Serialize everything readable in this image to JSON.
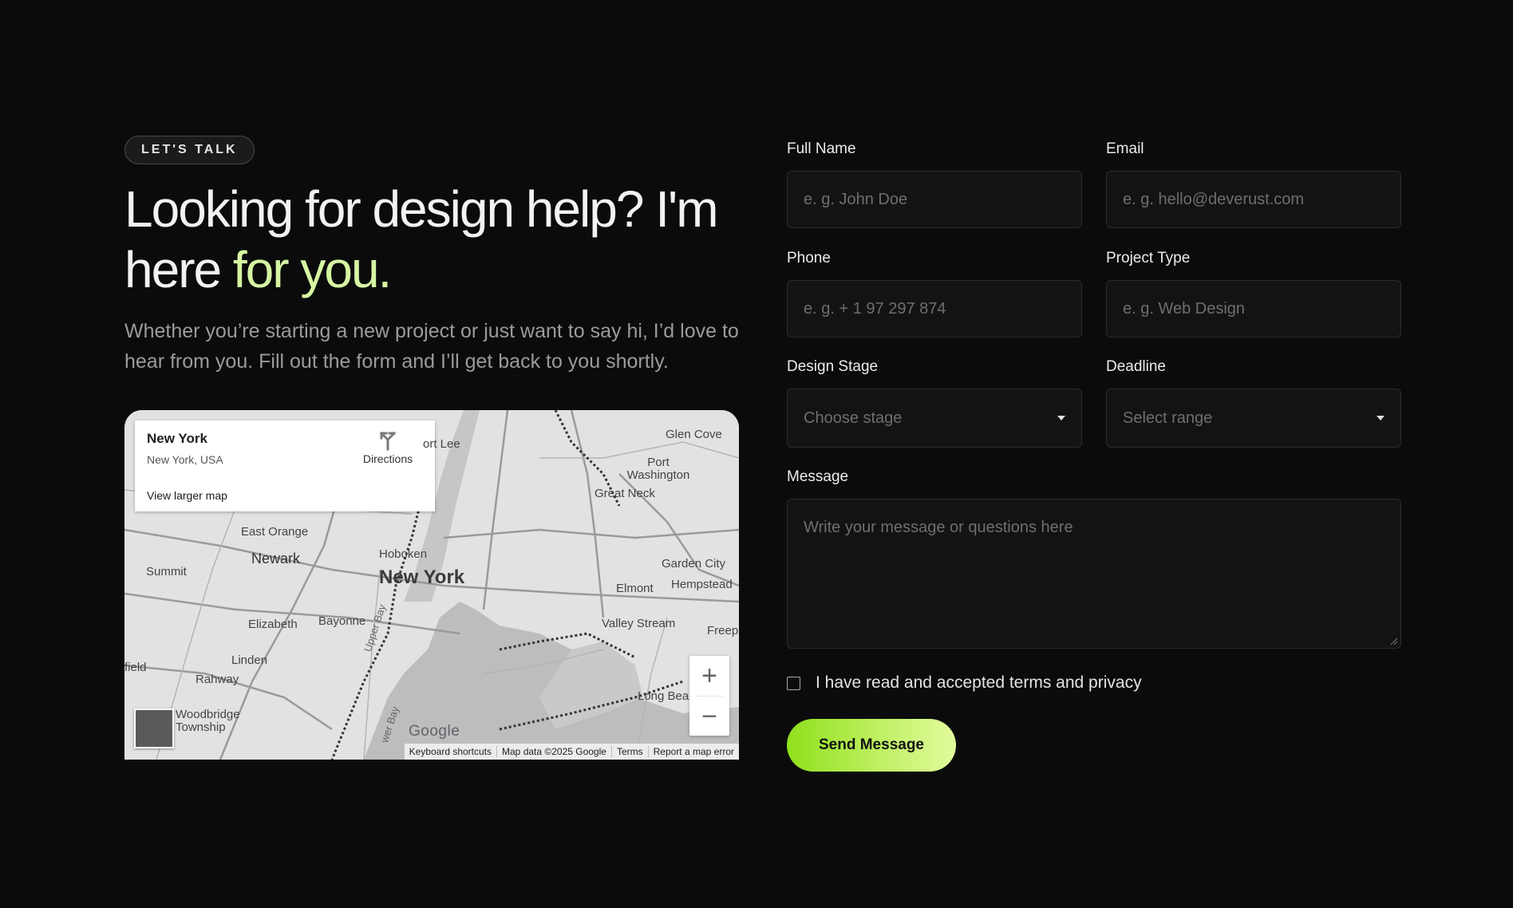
{
  "hero": {
    "badge": "LET'S TALK",
    "headline_line1": "Looking for design help? I'm",
    "headline_line2_plain": "here",
    "headline_line2_accent": "for you.",
    "lead": "Whether you’re starting a new project or just want to say hi, I’d love to hear from you. Fill out the form and I’ll get back to you shortly."
  },
  "map": {
    "place_title": "New York",
    "place_subtitle": "New York, USA",
    "view_larger": "View larger map",
    "directions_label": "Directions",
    "city_label": "New York",
    "labels": [
      "Glen Cove",
      "Port Washington",
      "Great Neck",
      "East Orange",
      "Newark",
      "Hoboken",
      "Summit",
      "Elizabeth",
      "Bayonne",
      "Garden City",
      "Hempstead",
      "Elmont",
      "Valley Stream",
      "Freep",
      "Linden",
      "Rahway",
      "Woodbridge Township",
      "field",
      "Upper Bay",
      "Long Beac",
      "ort Lee",
      "wer Bay"
    ],
    "google_logo": "Google",
    "attribution": [
      "Keyboard shortcuts",
      "Map data ©2025 Google",
      "Terms",
      "Report a map error"
    ],
    "zoom_in": "+",
    "zoom_out": "−"
  },
  "form": {
    "full_name": {
      "label": "Full Name",
      "placeholder": "e. g. John Doe"
    },
    "email": {
      "label": "Email",
      "placeholder": "e. g. hello@deverust.com"
    },
    "phone": {
      "label": "Phone",
      "placeholder": "e. g. + 1 97 297 874"
    },
    "project_type": {
      "label": "Project Type",
      "placeholder": "e. g. Web Design"
    },
    "design_stage": {
      "label": "Design Stage",
      "selected": "Choose stage"
    },
    "deadline": {
      "label": "Deadline",
      "selected": "Select range"
    },
    "message": {
      "label": "Message",
      "placeholder": "Write your message or questions here"
    },
    "terms": "I have read and accepted terms and privacy",
    "submit": "Send Message"
  },
  "colors": {
    "background": "#0b0b0b",
    "accent": "#d6f6a3",
    "button_gradient_start": "#8fe01c",
    "button_gradient_end": "#e2fb9e"
  }
}
